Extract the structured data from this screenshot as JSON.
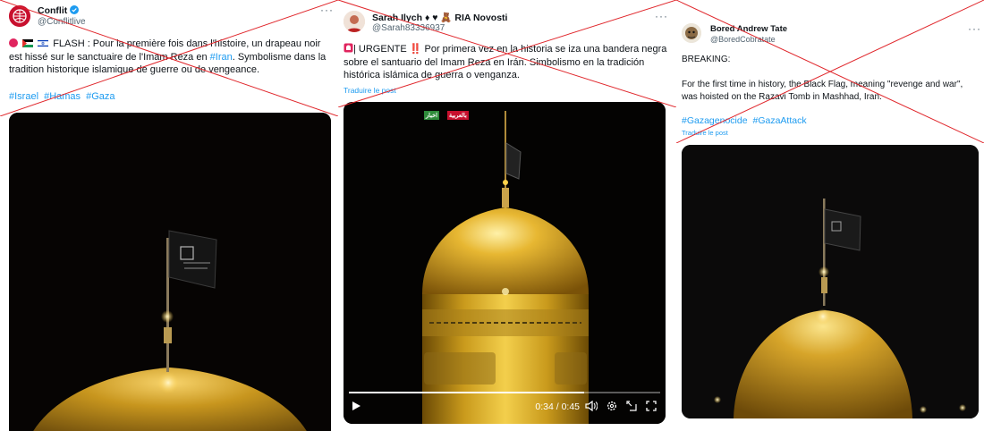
{
  "tweets": [
    {
      "author": "Conflit",
      "handle": "@Conflitlive",
      "verified": true,
      "text_flash": "FLASH : Pour la première fois dans l'histoire, un drapeau noir est hissé sur le sanctuaire de l'Imam Reza en ",
      "text_tag": "#Iran",
      "text_end": ". Symbolisme dans la tradition historique islamique de guerre ou de vengeance.",
      "hashtags": [
        "#Israel",
        "#Hamas",
        "#Gaza"
      ]
    },
    {
      "author": "Sarah Ilych ♦ ♥ 🧸 RIA Novosti",
      "handle": "@Sarah83336937",
      "text": "| URGENTE ‼️ Por primera vez en la historia se iza una bandera negra sobre el santuario del Imam Reza en Irán. Simbolismo en la tradición histórica islámica de guerra o venganza.",
      "translate": "Traduire le post",
      "video": {
        "time": "0:34 / 0:45",
        "progress": 0.756,
        "badge_left": "اخبار",
        "badge_right": "بالعربية"
      }
    },
    {
      "author": "Bored Andrew Tate",
      "handle": "@BoredCobratate",
      "text_line1": "BREAKING:",
      "text_line2": "For the first time in history, the Black Flag, meaning \"revenge and war\", was hoisted on the Razavi Tomb in Mashhad, Iran.",
      "hashtags": [
        "#Gazagenocide",
        "#GazaAttack"
      ],
      "translate": "Traduire le post"
    }
  ],
  "more_label": "···",
  "colors": {
    "link": "#1d9bf0",
    "cross": "#e0262b",
    "verified": "#1d9bf0",
    "gold": "#d4a017"
  }
}
